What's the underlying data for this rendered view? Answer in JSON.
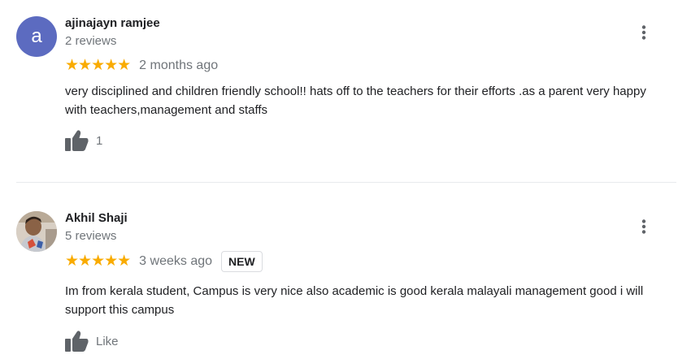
{
  "reviews": [
    {
      "avatar_letter": "a",
      "avatar_color": "#5c6bc0",
      "name": "ajinajayn ramjee",
      "review_count": "2 reviews",
      "stars": "★★★★★",
      "rating": 5,
      "date": "2 months ago",
      "text": "very disciplined and children friendly school!! hats off to the teachers for their efforts .as a parent very happy with teachers,management and staffs",
      "like_label": "1",
      "like_icon": "thumb-up-icon",
      "more_icon": "more-vert-icon"
    },
    {
      "avatar_type": "photo",
      "name": "Akhil Shaji",
      "review_count": "5 reviews",
      "stars": "★★★★★",
      "rating": 5,
      "date": "3 weeks ago",
      "badge": "NEW",
      "text": "Im from kerala student, Campus is very nice also academic is good kerala malayali management good i will support this campus",
      "like_label": "Like",
      "like_icon": "thumb-up-icon",
      "more_icon": "more-vert-icon"
    }
  ],
  "colors": {
    "star": "#f9ab00",
    "secondary_text": "#70757a",
    "primary_text": "#202124",
    "icon": "#5f6368",
    "divider": "#e8eaed"
  }
}
